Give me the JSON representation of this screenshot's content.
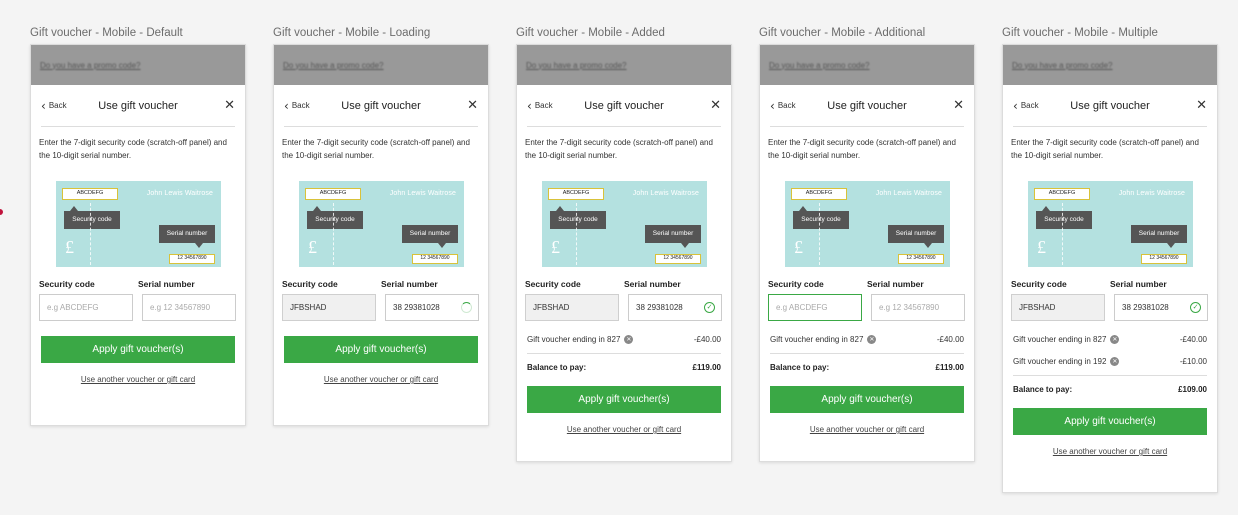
{
  "frames": [
    {
      "title": "Gift voucher - Mobile - Default"
    },
    {
      "title": "Gift voucher - Mobile - Loading"
    },
    {
      "title": "Gift voucher - Mobile - Added"
    },
    {
      "title": "Gift voucher - Mobile - Additional"
    },
    {
      "title": "Gift voucher - Mobile - Multiple"
    }
  ],
  "promo": {
    "link": "Do you have a promo code?"
  },
  "header": {
    "back": "Back",
    "title": "Use gift voucher",
    "close_icon": "close-icon"
  },
  "instructions": "Enter the 7-digit security code (scratch-off panel) and the 10-digit serial number.",
  "illustration": {
    "code_sample": "ABCDEFG",
    "brand": "John Lewis  Waitrose",
    "security_tip": "Security code",
    "serial_tip": "Serial number",
    "serial_sample": "12 34567890",
    "pound": "£"
  },
  "form": {
    "security_label": "Security code",
    "serial_label": "Serial number",
    "security_placeholder": "e.g ABCDEFG",
    "serial_placeholder": "e.g 12 34567890",
    "security_value": "JFBSHAD",
    "serial_value": "38 29381028"
  },
  "vouchers": {
    "v827": {
      "label": "Gift voucher ending in 827",
      "amount": "-£40.00"
    },
    "v192": {
      "label": "Gift voucher ending in 192",
      "amount": "-£10.00"
    }
  },
  "balance": {
    "label": "Balance to pay:",
    "added": "£119.00",
    "multiple": "£109.00"
  },
  "buttons": {
    "apply": "Apply gift voucher(s)",
    "another": "Use another voucher or gift card"
  },
  "colors": {
    "accent": "#3aa845",
    "illustration_bg": "#b4e1e0",
    "promo_bg": "#999999"
  }
}
